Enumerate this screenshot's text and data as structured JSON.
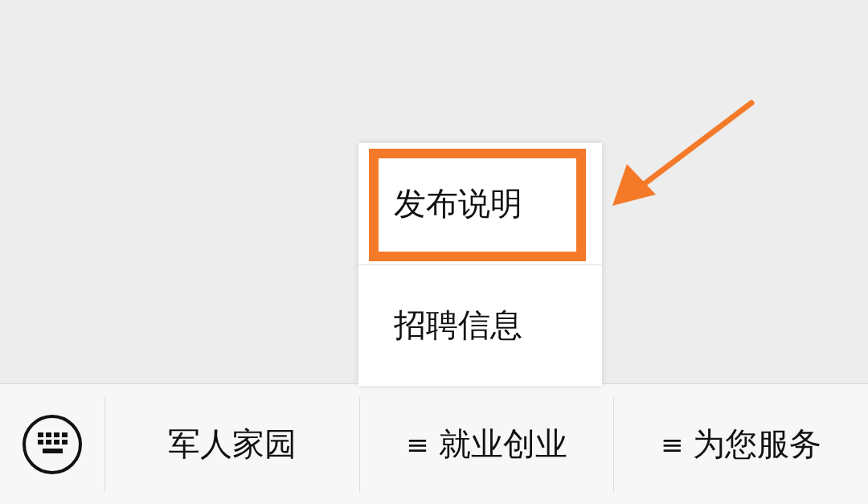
{
  "bottom_menu": [
    {
      "label": "军人家园"
    },
    {
      "label": "就业创业",
      "mark": "≡",
      "submenu": [
        {
          "label": "发布说明",
          "highlighted": true
        },
        {
          "label": "招聘信息",
          "highlighted": false
        }
      ]
    },
    {
      "label": "为您服务",
      "mark": "≡"
    }
  ]
}
